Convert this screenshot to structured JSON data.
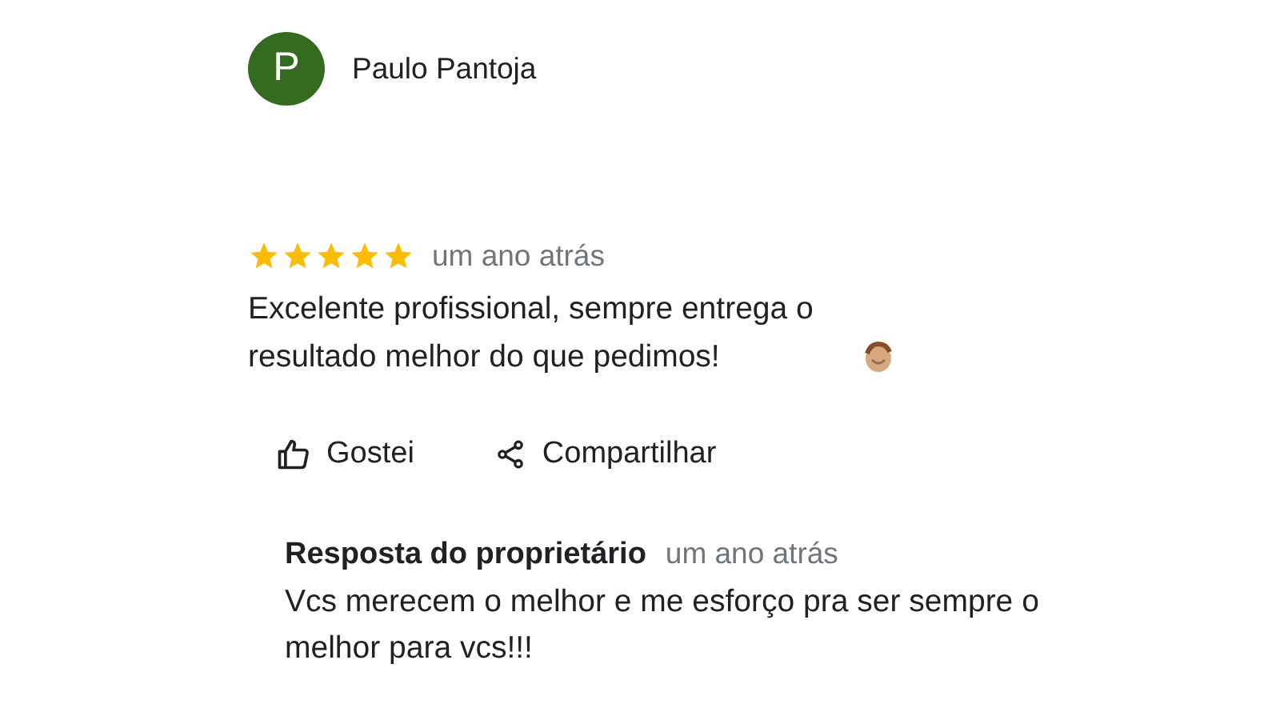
{
  "reviewer": {
    "initial": "P",
    "name": "Paulo Pantoja",
    "color": "#356b1f"
  },
  "review": {
    "stars": 5,
    "time": "um ano atrás",
    "text": "Excelente profissional, sempre entrega o resultado melhor do que pedimos!"
  },
  "actions": [
    {
      "kind": "like",
      "label": "Gostei"
    },
    {
      "kind": "share",
      "label": "Compartilhar"
    }
  ],
  "owner_reply": {
    "title": "Resposta do proprietário",
    "time": "um ano atrás",
    "text": "Vcs merecem o melhor e me esforço pra ser sempre o melhor para vcs!!!"
  }
}
